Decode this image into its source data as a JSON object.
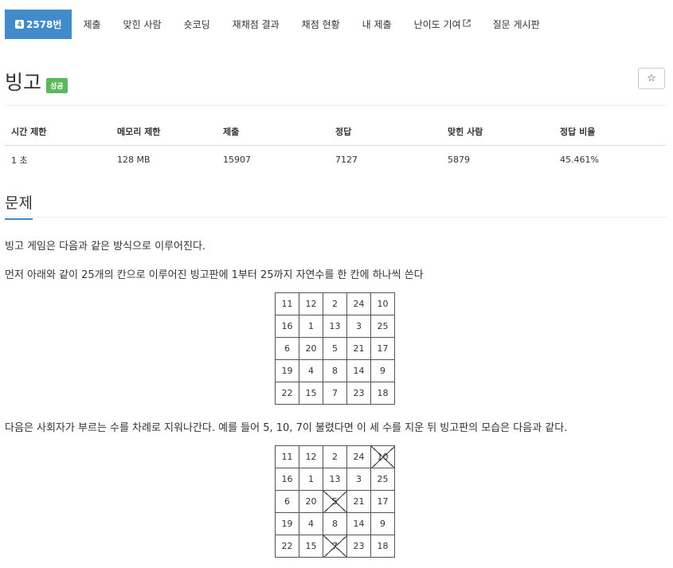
{
  "nav": [
    {
      "label": "2578번",
      "icon": "problem-badge-icon",
      "icon_glyph": "4",
      "active": true
    },
    {
      "label": "제출"
    },
    {
      "label": "맞힌 사람"
    },
    {
      "label": "숏코딩"
    },
    {
      "label": "재채점 결과"
    },
    {
      "label": "채점 현황"
    },
    {
      "label": "내 제출"
    },
    {
      "label": "난이도 기여",
      "icon": "external-link-icon"
    },
    {
      "label": "질문 게시판"
    }
  ],
  "problem": {
    "title": "빙고",
    "status": "성공",
    "star_icon": "☆"
  },
  "info": {
    "headers": [
      "시간 제한",
      "메모리 제한",
      "제출",
      "정답",
      "맞힌 사람",
      "정답 비율"
    ],
    "values": [
      "1 초",
      "128 MB",
      "15907",
      "7127",
      "5879",
      "45.461%"
    ]
  },
  "section": {
    "title": "문제",
    "para1": "빙고 게임은 다음과 같은 방식으로 이루어진다.",
    "para2": "먼저 아래와 같이 25개의 칸으로 이루어진 빙고판에 1부터 25까지 자연수를 한 칸에 하나씩 쓴다",
    "para3": "다음은 사회자가 부르는 수를 차례로 지워나간다. 예를 들어 5, 10, 7이 불렸다면 이 세 수를 지운 뒤 빙고판의 모습은 다음과 같다."
  },
  "board1": [
    [
      "11",
      "12",
      "2",
      "24",
      "10"
    ],
    [
      "16",
      "1",
      "13",
      "3",
      "25"
    ],
    [
      "6",
      "20",
      "5",
      "21",
      "17"
    ],
    [
      "19",
      "4",
      "8",
      "14",
      "9"
    ],
    [
      "22",
      "15",
      "7",
      "23",
      "18"
    ]
  ],
  "board2": [
    [
      "11",
      "12",
      "2",
      "24",
      "10"
    ],
    [
      "16",
      "1",
      "13",
      "3",
      "25"
    ],
    [
      "6",
      "20",
      "5",
      "21",
      "17"
    ],
    [
      "19",
      "4",
      "8",
      "14",
      "9"
    ],
    [
      "22",
      "15",
      "7",
      "23",
      "18"
    ]
  ],
  "board2_crossed": [
    "10",
    "5",
    "7"
  ],
  "colors": {
    "accent": "#428bca",
    "success": "#5cb85c"
  }
}
